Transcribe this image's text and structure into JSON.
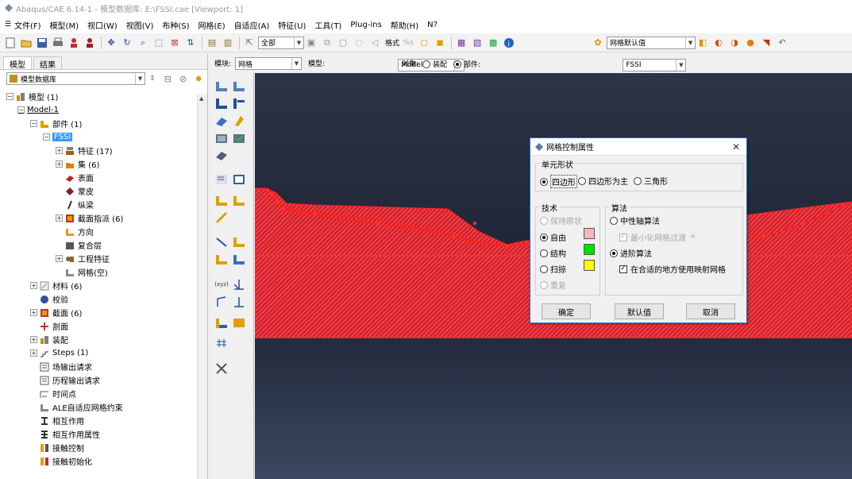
{
  "window": {
    "title": "Abaqus/CAE 6.14-1 - 模型数据库: E:\\FSSI.cae [Viewport: 1]"
  },
  "menu": [
    "文件(F)",
    "模型(M)",
    "视口(W)",
    "视图(V)",
    "布种(S)",
    "网格(E)",
    "自适应(A)",
    "特征(U)",
    "工具(T)",
    "Plug-ins",
    "帮助(H)",
    "N?"
  ],
  "toolbar": {
    "select_filter": "全部",
    "format_label": "格式",
    "mesh_default": "网格默认值"
  },
  "context": {
    "module_label": "模块:",
    "module_value": "网格",
    "model_label": "模型:",
    "model_value": "Model-1",
    "object_label": "对象:",
    "assembly": "装配",
    "part_label": "部件:",
    "part_value": "FSSI"
  },
  "left": {
    "tabs": [
      "模型",
      "结果"
    ],
    "db_label": "模型数据库",
    "tree": {
      "models": "模型 (1)",
      "model1": "Model-1",
      "parts": "部件 (1)",
      "fssi": "FSSI",
      "features": "特征 (17)",
      "sets": "集 (6)",
      "surfaces": "表面",
      "skins": "蒙皮",
      "stringers": "纵梁",
      "section_assign": "截面指派 (6)",
      "orientations": "方向",
      "composite": "复合层",
      "eng_features": "工程特征",
      "mesh_empty": "网格(空)",
      "materials": "材料 (6)",
      "calibrations": "校验",
      "sections": "截面 (6)",
      "profiles": "剖面",
      "assembly": "装配",
      "steps": "Steps (1)",
      "field_output": "场输出请求",
      "history_output": "历程输出请求",
      "time_points": "时间点",
      "ale": "ALE自适应网格约束",
      "interactions": "相互作用",
      "interaction_props": "相互作用属性",
      "contact_controls": "接触控制",
      "contact_init": "接触初始化"
    }
  },
  "dialog": {
    "title": "网格控制属性",
    "element_shape_group": "单元形状",
    "shape_quad": "四边形",
    "shape_quad_dominated": "四边形为主",
    "shape_tri": "三角形",
    "technique_group": "技术",
    "tech_as_is": "保持原状",
    "tech_free": "自由",
    "tech_structured": "结构",
    "tech_sweep": "扫掠",
    "tech_bottom_up": "重复",
    "algorithm_group": "算法",
    "algo_medial_axis": "中性轴算法",
    "algo_minimize_transition": "最小化网格过渡",
    "algo_advancing_front": "进阶算法",
    "algo_mapped_meshing": "在合适的地方使用映射网格",
    "ok": "确定",
    "defaults": "默认值",
    "cancel": "取消"
  },
  "colors": {
    "free": "#f5b8c0",
    "structured": "#00e000",
    "sweep": "#ffff00",
    "part_fill": "#d9222b",
    "selected_edge": "#ff3030"
  }
}
